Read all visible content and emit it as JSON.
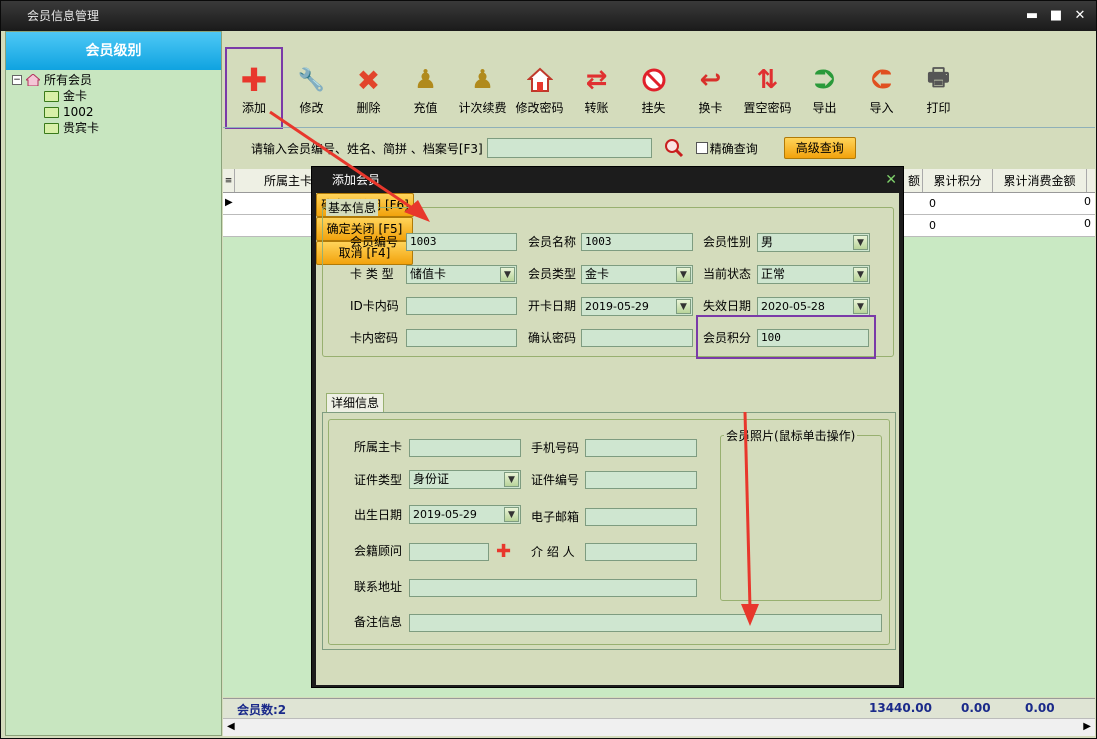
{
  "window": {
    "title": "会员信息管理"
  },
  "left_panel": {
    "header": "会员级别",
    "tree": {
      "root": "所有会员",
      "children": [
        "金卡",
        "1002",
        "贵宾卡"
      ]
    }
  },
  "toolbar": {
    "items": [
      {
        "label": "添加",
        "icon": "plus-icon"
      },
      {
        "label": "修改",
        "icon": "wrench-icon"
      },
      {
        "label": "删除",
        "icon": "delete-x-icon"
      },
      {
        "label": "充值",
        "icon": "pawn-icon"
      },
      {
        "label": "计次续费",
        "icon": "pawn-icon"
      },
      {
        "label": "修改密码",
        "icon": "home-key-icon"
      },
      {
        "label": "转账",
        "icon": "transfer-icon"
      },
      {
        "label": "挂失",
        "icon": "no-entry-icon"
      },
      {
        "label": "换卡",
        "icon": "swap-card-icon"
      },
      {
        "label": "置空密码",
        "icon": "clear-password-icon"
      },
      {
        "label": "导出",
        "icon": "export-icon"
      },
      {
        "label": "导入",
        "icon": "import-icon"
      },
      {
        "label": "打印",
        "icon": "printer-icon"
      }
    ]
  },
  "search": {
    "label": "请输入会员编号、姓名、简拼 、档案号[F3]",
    "value": "",
    "exact_label": "精确查询",
    "advanced_label": "高级查询"
  },
  "grid": {
    "columns": [
      "所属主卡",
      "额",
      "累计积分",
      "累计消费金额"
    ],
    "rows": [
      {
        "points": "0",
        "spend": "0"
      },
      {
        "points": "0",
        "spend": "0"
      }
    ]
  },
  "status": {
    "count_label": "会员数:2",
    "total1": "13440.00",
    "total2": "0.00",
    "total3": "0.00"
  },
  "dialog": {
    "title": "添加会员",
    "basic_group": "基本信息",
    "fields": {
      "member_no_label": "会员编号",
      "member_no": "1003",
      "member_name_label": "会员名称",
      "member_name": "1003",
      "gender_label": "会员性别",
      "gender": "男",
      "card_type_label": "卡 类 型",
      "card_type": "储值卡",
      "member_type_label": "会员类型",
      "member_type": "金卡",
      "status_label": "当前状态",
      "status": "正常",
      "id_card_label": "ID卡内码",
      "id_card": "",
      "open_date_label": "开卡日期",
      "open_date": "2019-05-29",
      "expire_label": "失效日期",
      "expire_date": "2020-05-28",
      "card_pwd_label": "卡内密码",
      "card_pwd": "",
      "confirm_pwd_label": "确认密码",
      "confirm_pwd": "",
      "points_label": "会员积分",
      "points": "100"
    },
    "detail_tab": "详细信息",
    "detail": {
      "main_card_label": "所属主卡",
      "main_card": "",
      "phone_label": "手机号码",
      "phone": "",
      "id_type_label": "证件类型",
      "id_type": "身份证",
      "id_no_label": "证件编号",
      "id_no": "",
      "birth_label": "出生日期",
      "birth": "2019-05-29",
      "email_label": "电子邮箱",
      "email": "",
      "advisor_label": "会籍顾问",
      "advisor": "",
      "referrer_label": "介 绍 人",
      "referrer": "",
      "address_label": "联系地址",
      "address": "",
      "note_label": "备注信息",
      "note": "",
      "photo_label": "会员照片(鼠标单击操作)"
    },
    "buttons": {
      "ok_keep": "确定不关闭 [F6]",
      "ok_close": "确定关闭 [F5]",
      "cancel": "取消 [F4]"
    }
  },
  "colors": {
    "accent_purple": "#7a3aa8",
    "arrow_red": "#e8372c",
    "header_blue": "#1aa8e6",
    "button_orange": "#f6b21c"
  }
}
